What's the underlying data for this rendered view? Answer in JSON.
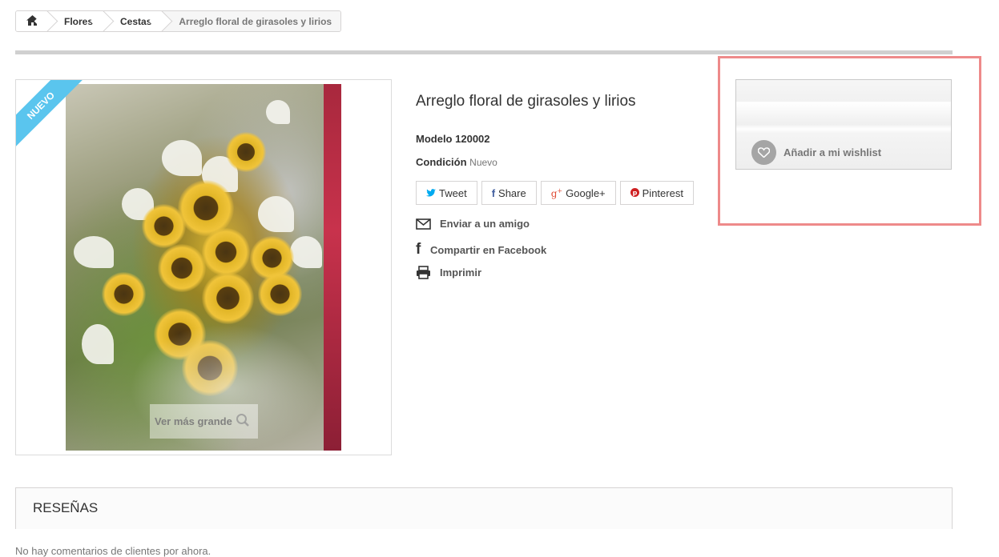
{
  "breadcrumb": {
    "home_icon": "home-icon",
    "items": [
      "Flores",
      "Cestas"
    ],
    "current": "Arreglo floral de girasoles y lirios"
  },
  "product": {
    "badge": "Nuevo",
    "zoom_label": "Ver más grande",
    "title": "Arreglo floral de girasoles y lirios",
    "model_label": "Modelo",
    "model_value": "120002",
    "condition_label": "Condición",
    "condition_value": "Nuevo"
  },
  "social": [
    {
      "icon": "twitter-icon",
      "label": "Tweet",
      "color": "#00aaf0"
    },
    {
      "icon": "facebook-icon",
      "label": "Share",
      "color": "#435f9f"
    },
    {
      "icon": "google-plus-icon",
      "label": "Google+",
      "color": "#e04b34"
    },
    {
      "icon": "pinterest-icon",
      "label": "Pinterest",
      "color": "#ce1f21"
    }
  ],
  "extra_links": {
    "send_friend": "Enviar a un amigo",
    "share_facebook": "Compartir en Facebook",
    "print": "Imprimir"
  },
  "wishlist": {
    "label": "Añadir a mi wishlist"
  },
  "reviews": {
    "title": "Reseñas",
    "text": "No hay comentarios de clientes por ahora."
  },
  "colors": {
    "badge": "#5ac5ee",
    "highlight": "#ee8a8a"
  }
}
